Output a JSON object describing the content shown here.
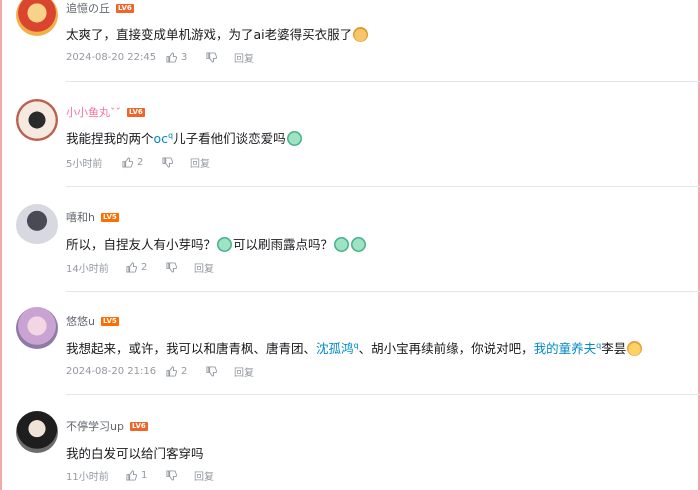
{
  "comments": [
    {
      "username": "追憶の丘",
      "level": "LV6",
      "text_before": "太爽了，直接变成单机游戏，为了ai老婆得买衣服了",
      "emoji_end": "dog-emoji",
      "time": "2024-08-20 22:45",
      "likes": "3",
      "reply": "回复"
    },
    {
      "username": "小小鱼丸ˇˇ",
      "level": "LV6",
      "text_pre": "我能捏我的两个",
      "link1": "oc",
      "text_post": "儿子看他们谈恋爱吗",
      "time": "5小时前",
      "likes": "2",
      "reply": "回复"
    },
    {
      "username": "嘻和h",
      "level": "LV5",
      "text_a": "所以，自捏友人有小芽吗？",
      "text_b": "可以刷雨露点吗？",
      "time": "14小时前",
      "likes": "2",
      "reply": "回复"
    },
    {
      "username": "悠悠u",
      "level": "LV5",
      "text_a": "我想起来，或许，我可以和唐青枫、唐青团、",
      "link1": "沈孤鸿",
      "text_b": "、胡小宝再续前缘，你说对吧，",
      "link2": "我的童养夫",
      "text_c": "李昙",
      "time": "2024-08-20 21:16",
      "likes": "2",
      "reply": "回复"
    },
    {
      "username": "不停学习up",
      "level": "LV6",
      "text": "我的白发可以给门客穿吗",
      "time": "11小时前",
      "likes": "1",
      "reply": "回复"
    }
  ],
  "colors": {
    "link": "#008ac5",
    "pink_name": "#fb7299",
    "level_badge": "#ff6c00",
    "muted": "#9499a0"
  }
}
